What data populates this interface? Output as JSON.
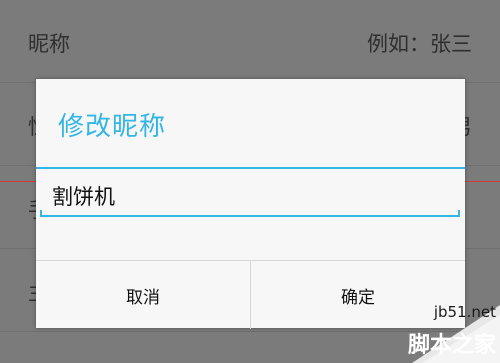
{
  "background_list": {
    "rows": [
      {
        "label": "昵称",
        "value": "例如：张三"
      },
      {
        "label": "性",
        "value": "男"
      },
      {
        "label": "手",
        "value": ""
      },
      {
        "label": "主",
        "value": ""
      }
    ]
  },
  "dialog": {
    "title": "修改昵称",
    "input_value": "割饼机",
    "cancel_label": "取消",
    "ok_label": "确定"
  },
  "watermark": {
    "site": "jb51.net",
    "name": "脚本之家"
  },
  "colors": {
    "accent": "#33b5e5",
    "overlay": "#7b7b7b",
    "divider_red": "#d23a3a"
  }
}
